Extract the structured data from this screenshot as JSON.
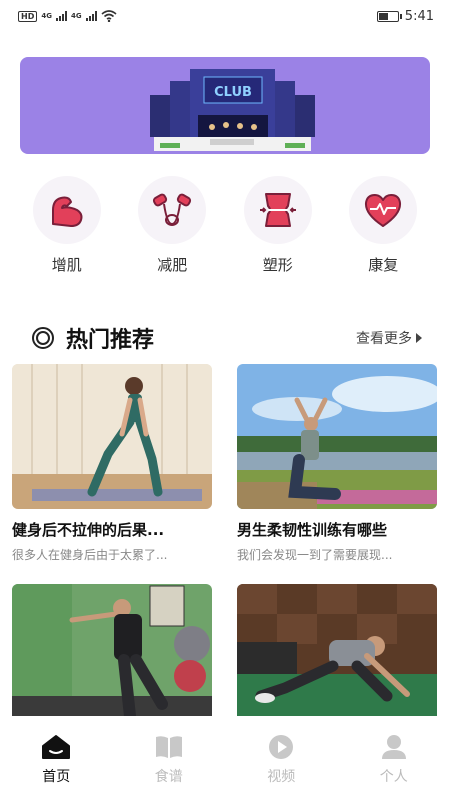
{
  "status_bar": {
    "network_label": "HD",
    "sim1": "4G",
    "sim2": "4G",
    "battery_level": 0.55,
    "time": "5:41"
  },
  "banner": {
    "sign_text": "CLUB",
    "background_color": "#9b82e6"
  },
  "categories": [
    {
      "label": "增肌",
      "icon": "muscle-arm-icon"
    },
    {
      "label": "减肥",
      "icon": "jump-rope-icon"
    },
    {
      "label": "塑形",
      "icon": "waist-shaping-icon"
    },
    {
      "label": "康复",
      "icon": "heart-pulse-icon"
    }
  ],
  "section": {
    "title": "热门推荐",
    "more_label": "查看更多"
  },
  "cards": [
    {
      "title": "健身后不拉伸的后果...",
      "summary": "很多人在健身后由于太累了..."
    },
    {
      "title": "男生柔韧性训练有哪些",
      "summary": "我们会发现一到了需要展现..."
    },
    {
      "title": "",
      "summary": ""
    },
    {
      "title": "",
      "summary": ""
    }
  ],
  "nav": {
    "items": [
      {
        "label": "首页",
        "icon": "home-icon",
        "active": true
      },
      {
        "label": "食谱",
        "icon": "book-icon",
        "active": false
      },
      {
        "label": "视频",
        "icon": "play-icon",
        "active": false
      },
      {
        "label": "个人",
        "icon": "person-icon",
        "active": false
      }
    ]
  },
  "colors": {
    "accent": "#e2405a",
    "nav_active": "#111111",
    "nav_inactive": "#bbbbbb"
  }
}
